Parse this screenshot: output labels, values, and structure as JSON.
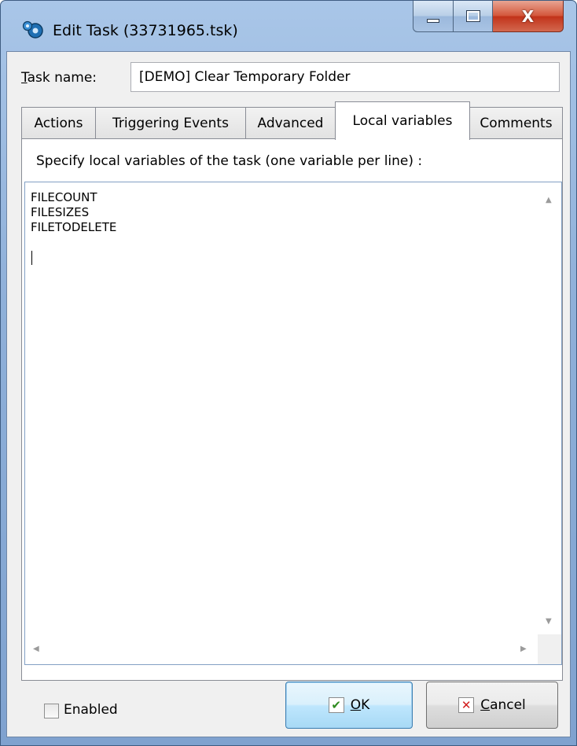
{
  "window": {
    "title": "Edit Task (33731965.tsk)",
    "caption_buttons": {
      "minimize": "minimize",
      "maximize": "maximize",
      "close": "X"
    }
  },
  "task_name": {
    "label_accel": "T",
    "label_rest": "ask name:",
    "value": "[DEMO] Clear Temporary Folder"
  },
  "tabs": [
    {
      "label": "Actions",
      "active": false
    },
    {
      "label": "Triggering Events",
      "active": false
    },
    {
      "label": "Advanced",
      "active": false
    },
    {
      "label": "Local variables",
      "active": true
    },
    {
      "label": "Comments",
      "active": false
    }
  ],
  "panel": {
    "caption": "Specify local variables of the task (one variable per line) :",
    "variables": [
      "FILECOUNT",
      "FILESIZES",
      "FILETODELETE"
    ]
  },
  "footer": {
    "enabled_label": "Enabled",
    "enabled_checked": false,
    "ok_accel": "O",
    "ok_rest": "K",
    "cancel_accel": "C",
    "cancel_rest": "ancel"
  },
  "colors": {
    "accent_frame": "#8fb0d9",
    "ok_check": "#2e8b1f",
    "cancel_x": "#d21d1d"
  }
}
